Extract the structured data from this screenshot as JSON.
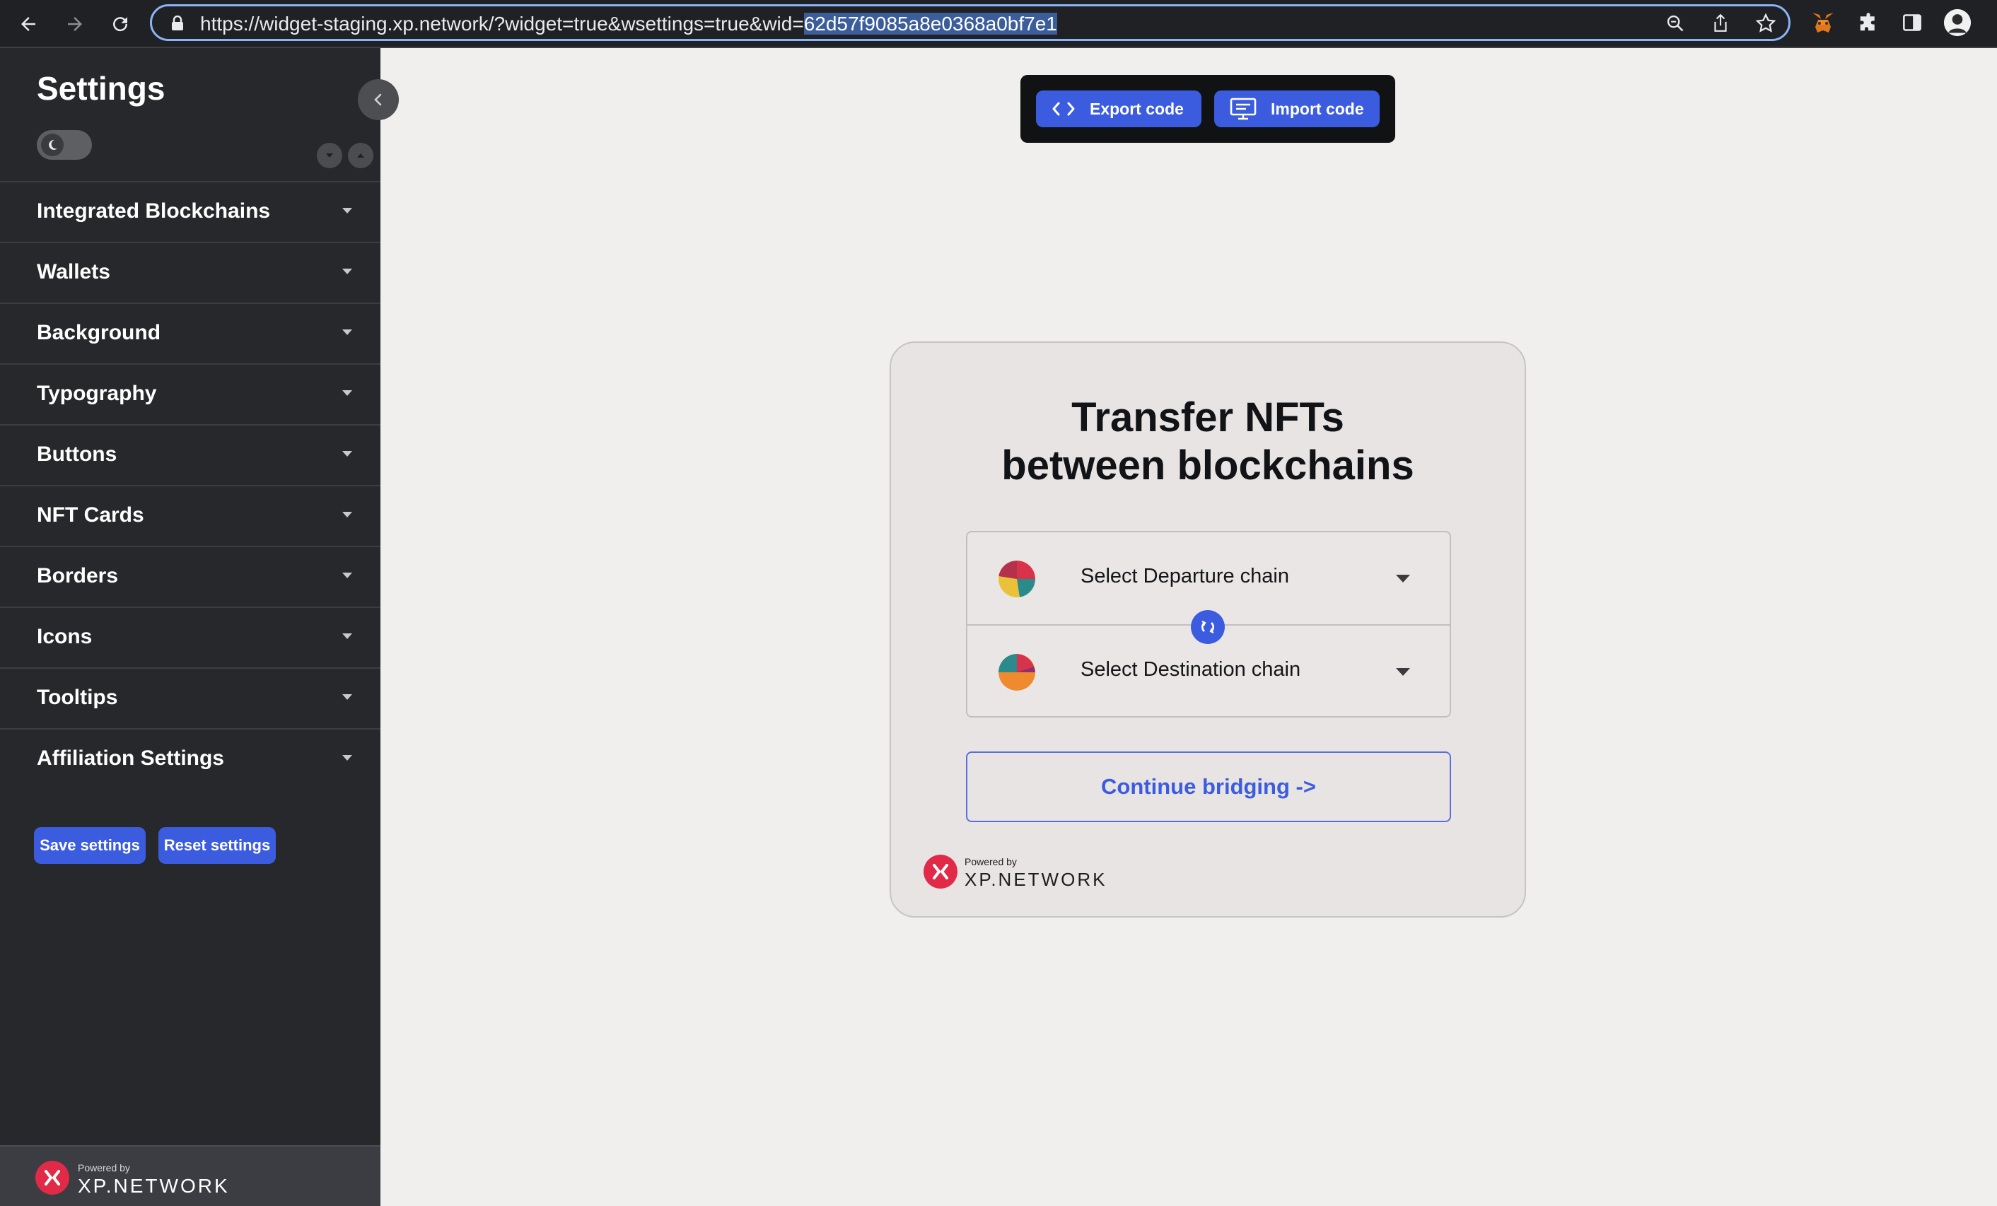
{
  "browser": {
    "url_main": "https://widget-staging.xp.network/?widget=true&wsettings=true&wid=",
    "url_selected": "62d57f9085a8e0368a0bf7e1"
  },
  "sidebar": {
    "title": "Settings",
    "items": [
      {
        "label": "Integrated Blockchains"
      },
      {
        "label": "Wallets"
      },
      {
        "label": "Background"
      },
      {
        "label": "Typography"
      },
      {
        "label": "Buttons"
      },
      {
        "label": "NFT Cards"
      },
      {
        "label": "Borders"
      },
      {
        "label": "Icons"
      },
      {
        "label": "Tooltips"
      },
      {
        "label": "Affiliation Settings"
      }
    ],
    "save_label": "Save settings",
    "reset_label": "Reset settings",
    "footer": {
      "powered": "Powered by",
      "brand": "XP.NETWORK"
    }
  },
  "toolbar": {
    "export_label": "Export code",
    "import_label": "Import code"
  },
  "widget": {
    "title_line1": "Transfer NFTs",
    "title_line2": "between blockchains",
    "departure_label": "Select Departure chain",
    "destination_label": "Select Destination chain",
    "continue_label": "Continue bridging ->",
    "footer": {
      "powered": "Powered by",
      "brand": "XP.NETWORK"
    }
  },
  "colors": {
    "accent": "#3c5ce0",
    "sidebar_bg": "#27282b",
    "canvas_bg": "#f0efee",
    "brand_red": "#e02a47"
  }
}
